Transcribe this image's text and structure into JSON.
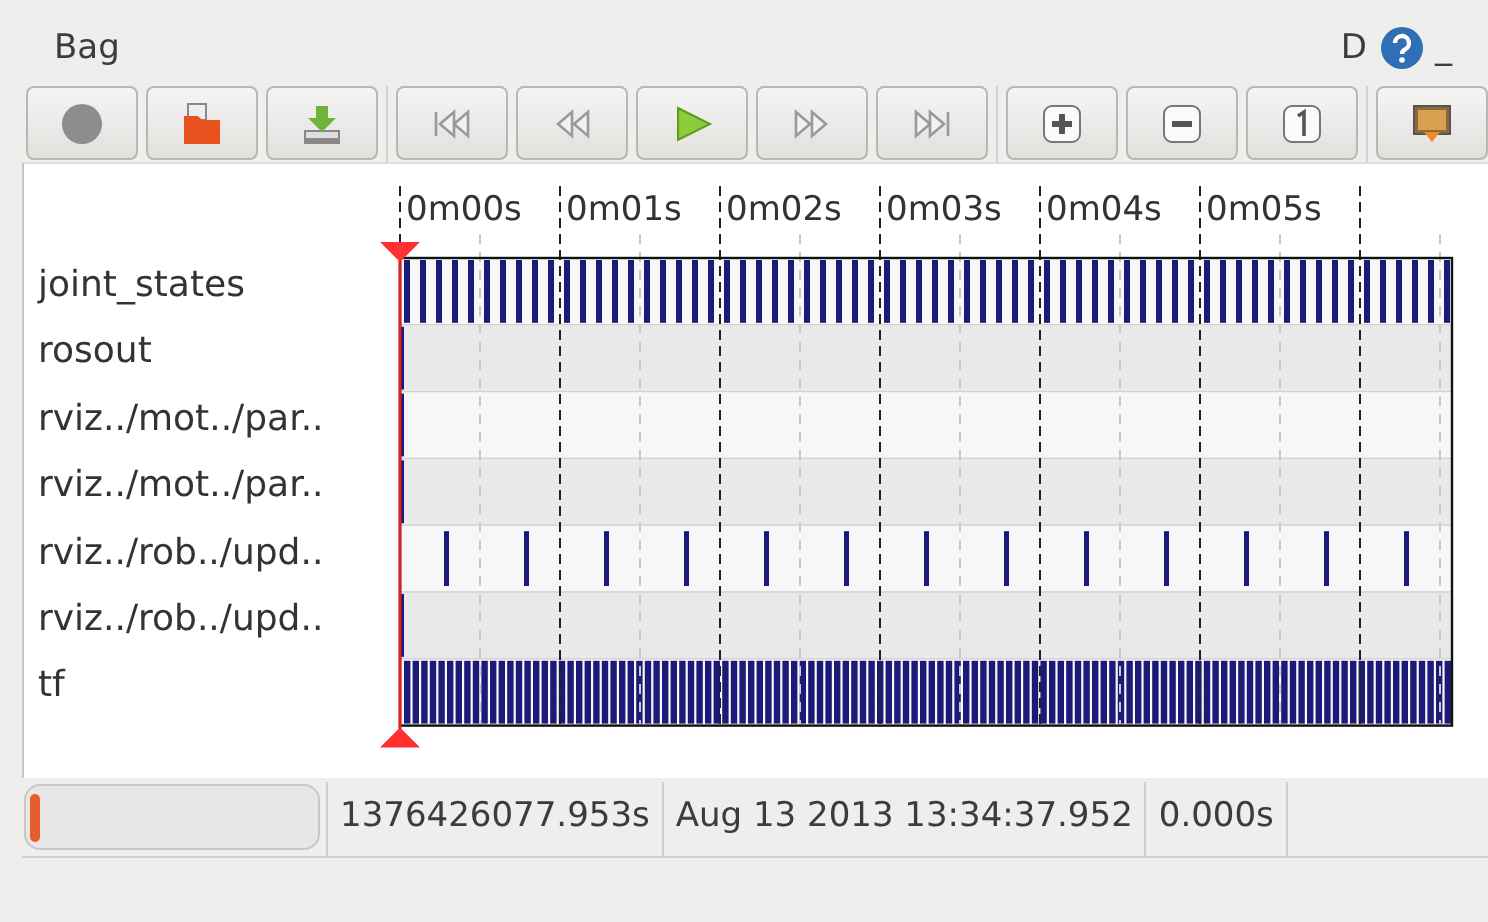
{
  "window": {
    "title": "Bag",
    "controls": [
      {
        "kind": "text",
        "label": "D"
      },
      {
        "kind": "help"
      },
      {
        "kind": "text",
        "label": "_"
      }
    ]
  },
  "toolbar": {
    "groups": [
      [
        {
          "kind": "record"
        },
        {
          "kind": "open"
        },
        {
          "kind": "save"
        }
      ],
      [
        {
          "kind": "begin"
        },
        {
          "kind": "rewind"
        },
        {
          "kind": "play"
        },
        {
          "kind": "forward"
        },
        {
          "kind": "end"
        }
      ],
      [
        {
          "kind": "zoom-in"
        },
        {
          "kind": "zoom-out"
        },
        {
          "kind": "zoom-reset"
        }
      ],
      [
        {
          "kind": "image"
        }
      ]
    ]
  },
  "timeline": {
    "ticks": [
      "0m00s",
      "0m01s",
      "0m02s",
      "0m03s",
      "0m04s",
      "0m05s"
    ],
    "topics": [
      {
        "name": "joint_states",
        "kind": "dense"
      },
      {
        "name": "rosout",
        "kind": "empty"
      },
      {
        "name": "rviz../mot../par..",
        "kind": "empty"
      },
      {
        "name": "rviz../mot../par..",
        "kind": "empty"
      },
      {
        "name": "rviz../rob../upd..",
        "kind": "sparse"
      },
      {
        "name": "rviz../rob../upd..",
        "kind": "empty"
      },
      {
        "name": "tf",
        "kind": "solid"
      }
    ]
  },
  "status_bar": {
    "progress": {
      "level": 0.03
    },
    "fields": [
      "1376426077.953s",
      "Aug 13 2013 13:34:37.952",
      "0.000s"
    ]
  }
}
